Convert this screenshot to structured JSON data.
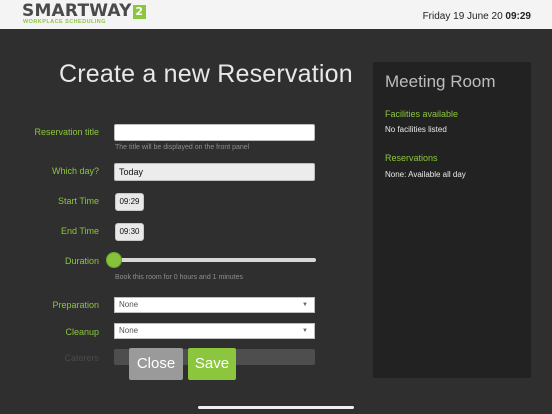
{
  "header": {
    "logo_text": "SMARTWAY",
    "logo_badge": "2",
    "logo_subtitle": "WORKPLACE SCHEDULING",
    "date": "Friday 19 June 20",
    "time": "09:29"
  },
  "form": {
    "title": "Create a new Reservation",
    "reservation_title": {
      "label": "Reservation title",
      "value": "",
      "hint": "The title will be displayed on the front panel"
    },
    "which_day": {
      "label": "Which day?",
      "value": "Today"
    },
    "start_time": {
      "label": "Start Time",
      "value": "09:29"
    },
    "end_time": {
      "label": "End Time",
      "value": "09:30"
    },
    "duration": {
      "label": "Duration",
      "hint": "Book this room for 0 hours and 1 minutes",
      "level": 0
    },
    "preparation": {
      "label": "Preparation",
      "value": "None"
    },
    "cleanup": {
      "label": "Cleanup",
      "value": "None"
    },
    "caterers": {
      "label": "Caterers"
    }
  },
  "buttons": {
    "close": "Close",
    "save": "Save"
  },
  "room_panel": {
    "title": "Meeting Room",
    "facilities_heading": "Facilities available",
    "facilities_text": "No facilities listed",
    "reservations_heading": "Reservations",
    "reservations_text": "None: Available all day"
  },
  "colors": {
    "accent": "#8cc63f",
    "background": "#2f2f2f",
    "panel": "#222222"
  },
  "icons": {
    "dropdown": "caret-down-icon"
  }
}
